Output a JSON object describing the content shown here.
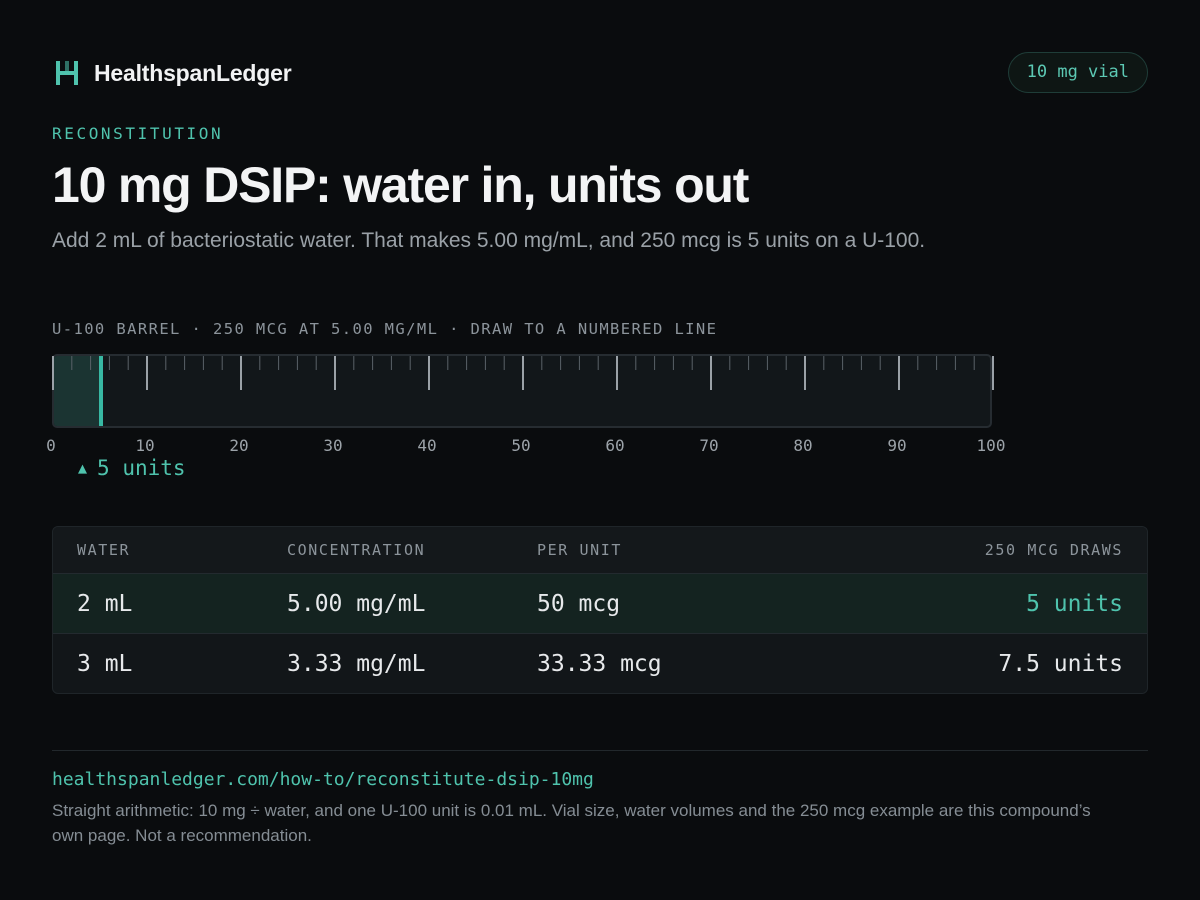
{
  "brand": {
    "name": "HealthspanLedger",
    "icon": "ledger-logo-icon",
    "accent_color": "#4fc3ad"
  },
  "header": {
    "vial_badge": "10 mg vial"
  },
  "hero": {
    "eyebrow": "RECONSTITUTION",
    "title": "10 mg DSIP: water in, units out",
    "subtitle": "Add 2 mL of bacteriostatic water. That makes 5.00 mg/mL, and 250 mcg is 5 units on a U-100."
  },
  "syringe": {
    "label": "U-100 BARREL · 250 MCG AT 5.00 MG/ML · DRAW TO A NUMBERED LINE",
    "min": 0,
    "max": 100,
    "draw_units": 5,
    "tick_labels": [
      "0",
      "10",
      "20",
      "30",
      "40",
      "50",
      "60",
      "70",
      "80",
      "90",
      "100"
    ],
    "marker_icon": "triangle-up-icon",
    "marker_arrow": "▲",
    "marker_label": "5 units"
  },
  "table": {
    "headers": [
      "WATER",
      "CONCENTRATION",
      "PER UNIT",
      "250 MCG DRAWS"
    ],
    "rows": [
      {
        "water": "2 mL",
        "concentration": "5.00 mg/mL",
        "per_unit": "50 mcg",
        "draws": "5 units",
        "highlight": true
      },
      {
        "water": "3 mL",
        "concentration": "3.33 mg/mL",
        "per_unit": "33.33 mcg",
        "draws": "7.5 units",
        "highlight": false
      }
    ]
  },
  "footer": {
    "url": "healthspanledger.com/how-to/reconstitute-dsip-10mg",
    "note": "Straight arithmetic: 10 mg ÷ water, and one U-100 unit is 0.01 mL. Vial size, water volumes and the 250 mcg example are this compound’s own page. Not a recommendation."
  }
}
